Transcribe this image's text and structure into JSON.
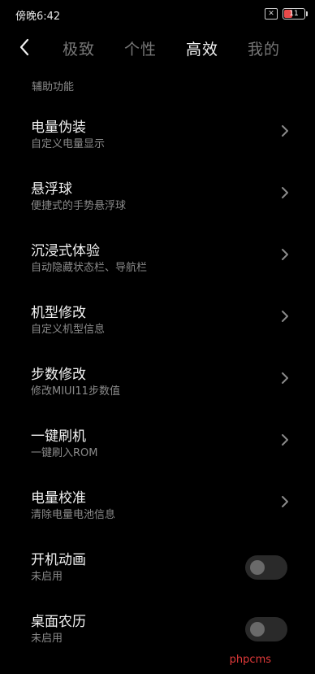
{
  "status_bar": {
    "time": "傍晚6:42",
    "x_icon_text": "✕",
    "battery_text": "11",
    "battery_color": "#e84a4a"
  },
  "nav": {
    "tabs": [
      {
        "label": "极致",
        "active": false
      },
      {
        "label": "个性",
        "active": false
      },
      {
        "label": "高效",
        "active": true
      },
      {
        "label": "我的",
        "active": false
      }
    ]
  },
  "section": {
    "title": "辅助功能"
  },
  "items": [
    {
      "title": "电量伪装",
      "subtitle": "自定义电量显示",
      "control": "chevron"
    },
    {
      "title": "悬浮球",
      "subtitle": "便捷式的手势悬浮球",
      "control": "chevron"
    },
    {
      "title": "沉浸式体验",
      "subtitle": "自动隐藏状态栏、导航栏",
      "control": "chevron"
    },
    {
      "title": "机型修改",
      "subtitle": "自定义机型信息",
      "control": "chevron"
    },
    {
      "title": "步数修改",
      "subtitle": "修改MIUI11步数值",
      "control": "chevron"
    },
    {
      "title": "一键刷机",
      "subtitle": "一键刷入ROM",
      "control": "chevron"
    },
    {
      "title": "电量校准",
      "subtitle": "清除电量电池信息",
      "control": "chevron"
    },
    {
      "title": "开机动画",
      "subtitle": "未启用",
      "control": "toggle",
      "enabled": false
    },
    {
      "title": "桌面农历",
      "subtitle": "未启用",
      "control": "toggle",
      "enabled": false
    }
  ],
  "watermark": "phpcms"
}
